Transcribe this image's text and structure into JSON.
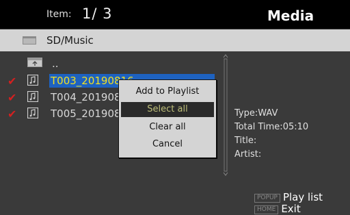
{
  "header": {
    "item_label": "Item:",
    "item_value": "1/ 3",
    "title": "Media"
  },
  "path": {
    "icon": "folder-icon",
    "text": "SD/Music"
  },
  "list": {
    "parent_label": "..",
    "rows": [
      {
        "checked": true,
        "name": "T003_20190816",
        "selected": true
      },
      {
        "checked": true,
        "name": "T004_201908",
        "selected": false
      },
      {
        "checked": true,
        "name": "T005_201908",
        "selected": false
      }
    ]
  },
  "popup": {
    "items": [
      {
        "label": "Add to Playlist",
        "highlighted": false
      },
      {
        "label": "Select all",
        "highlighted": true
      },
      {
        "label": "Clear all",
        "highlighted": false
      },
      {
        "label": "Cancel",
        "highlighted": false
      }
    ]
  },
  "info": {
    "type": "Type:WAV",
    "total_time": "Total Time:05:10",
    "title": "Title:",
    "artist": "Artist:"
  },
  "legend": {
    "popup_key": "POPUP",
    "popup_action": "Play list",
    "home_key": "HOME",
    "home_action": "Exit"
  },
  "colors": {
    "check": "#d42020",
    "selected_bg": "#1e62c0",
    "selected_text": "#f2e020"
  }
}
